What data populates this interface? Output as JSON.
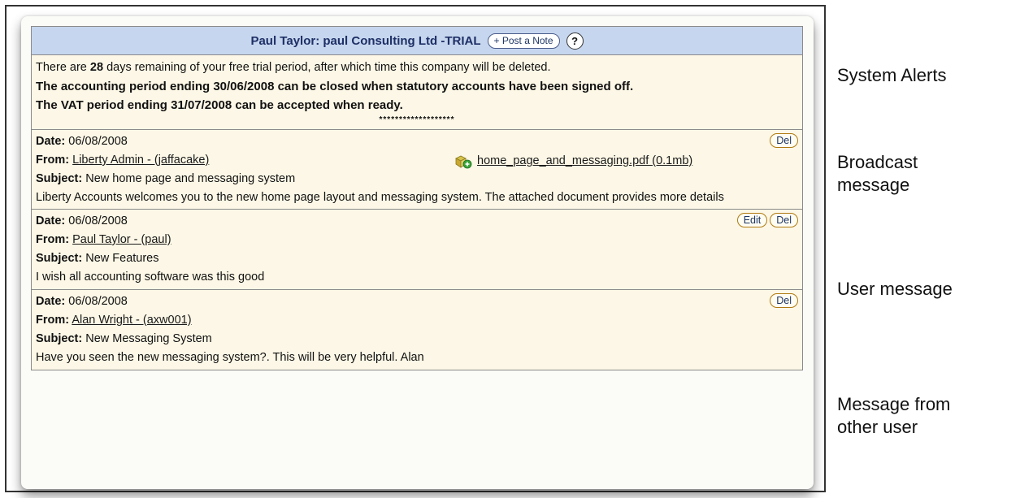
{
  "header": {
    "title": "Paul Taylor: paul Consulting Ltd -TRIAL",
    "post_note_label": "+ Post a Note",
    "help_label": "?"
  },
  "alerts": {
    "trial_prefix": "There are ",
    "trial_days": "28",
    "trial_suffix": " days remaining of your free trial period, after which time this company will be deleted.",
    "accounting_alert": "The accounting period ending 30/06/2008 can be closed when statutory accounts have been signed off.",
    "vat_alert": "The VAT period ending 31/07/2008 can be accepted when ready.",
    "separator": "*******************"
  },
  "labels": {
    "date": "Date:",
    "from": "From:",
    "subject": "Subject:"
  },
  "messages": [
    {
      "date": "06/08/2008",
      "from": "Liberty Admin - (jaffacake)",
      "subject": "New home page and messaging system",
      "body": "Liberty Accounts welcomes you to the new home page layout and messaging system. The attached document provides more details",
      "attachment": "home_page_and_messaging.pdf (0.1mb)",
      "del_label": "Del"
    },
    {
      "date": "06/08/2008",
      "from": "Paul Taylor - (paul)",
      "subject": "New Features",
      "body": "I wish all accounting software was this good",
      "edit_label": "Edit",
      "del_label": "Del"
    },
    {
      "date": "06/08/2008",
      "from": "Alan Wright - (axw001)",
      "subject": "New Messaging System",
      "body": "Have you seen the new messaging system?. This will be very helpful. Alan",
      "del_label": "Del"
    }
  ],
  "annotations": {
    "system_alerts": "System Alerts",
    "broadcast_line1": "Broadcast",
    "broadcast_line2": "message",
    "user_message": "User message",
    "other_line1": "Message from",
    "other_line2": "other user"
  },
  "icons": {
    "attachment": "attachment-icon"
  },
  "colors": {
    "header_bg": "#c6d6ee",
    "panel_bg": "#fcf7e6",
    "button_border": "#b07a10"
  }
}
